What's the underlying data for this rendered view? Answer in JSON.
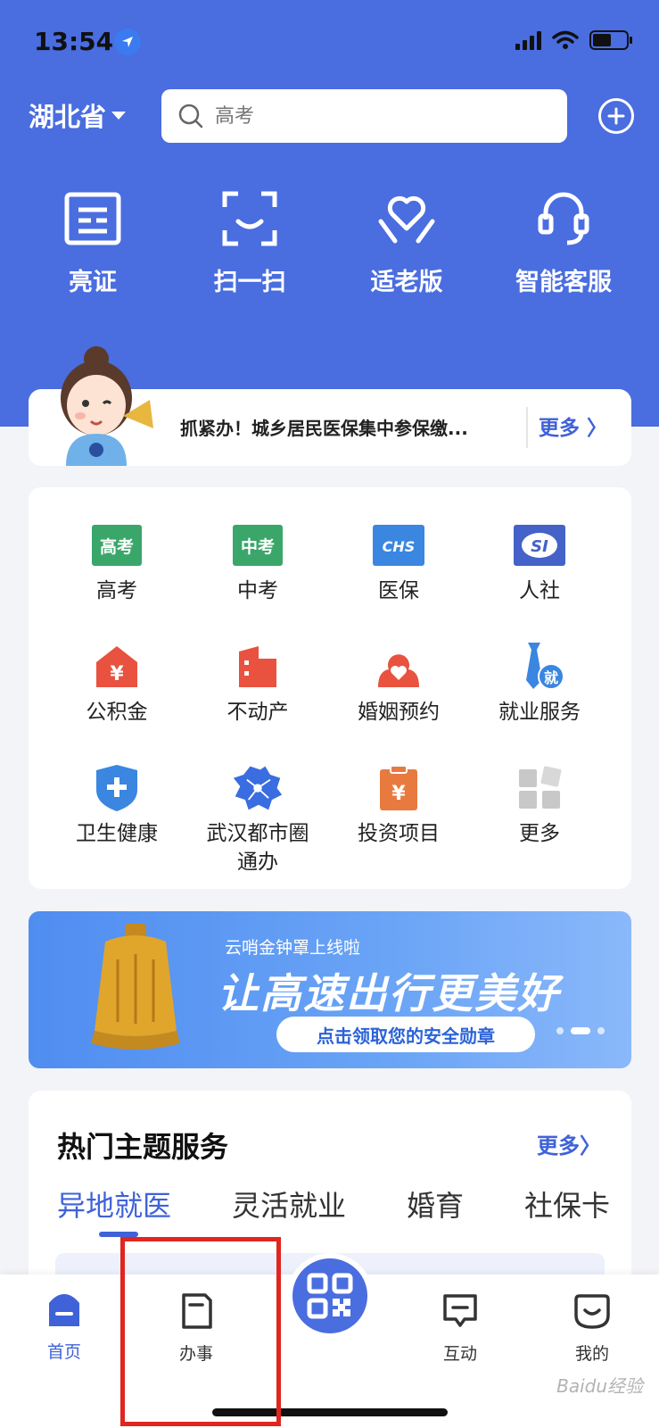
{
  "status_bar": {
    "time": "13:54"
  },
  "header": {
    "province": "湖北省",
    "search_placeholder": "高考"
  },
  "quick_actions": [
    {
      "label": "亮证",
      "icon": "id-card-icon"
    },
    {
      "label": "扫一扫",
      "icon": "scan-icon"
    },
    {
      "label": "适老版",
      "icon": "elderly-care-icon"
    },
    {
      "label": "智能客服",
      "icon": "headset-icon"
    }
  ],
  "notice": {
    "text": "抓紧办！城乡居民医保集中参保缴...",
    "more": "更多 〉"
  },
  "services": [
    {
      "label": "高考",
      "icon": "gaokao-icon",
      "badge": "高考",
      "color": "#3aa66a"
    },
    {
      "label": "中考",
      "icon": "zhongkao-icon",
      "badge": "中考",
      "color": "#3aa66a"
    },
    {
      "label": "医保",
      "icon": "chs-icon",
      "badge": "CHS",
      "color": "#3a86e0"
    },
    {
      "label": "人社",
      "icon": "social-security-icon",
      "badge": "SI",
      "color": "#4462c8"
    },
    {
      "label": "公积金",
      "icon": "housing-fund-icon",
      "badge": "¥",
      "color": "#e8523f"
    },
    {
      "label": "不动产",
      "icon": "real-estate-icon",
      "color": "#e8523f"
    },
    {
      "label": "婚姻预约",
      "icon": "marriage-icon",
      "color": "#e8523f"
    },
    {
      "label": "就业服务",
      "icon": "employment-icon",
      "badge": "就",
      "color": "#3a86e0"
    },
    {
      "label": "卫生健康",
      "icon": "health-icon",
      "color": "#3a86e0"
    },
    {
      "label": "武汉都市圈\n通办",
      "icon": "wuhan-map-icon",
      "color": "#3a6de0"
    },
    {
      "label": "投资项目",
      "icon": "investment-icon",
      "badge": "¥",
      "color": "#e87a3f"
    },
    {
      "label": "更多",
      "icon": "more-grid-icon",
      "color": "#c8c8c8"
    }
  ],
  "banner": {
    "subtitle": "云哨金钟罩上线啦",
    "title": "让高速出行更美好",
    "button": "点击领取您的安全勋章"
  },
  "topics": {
    "title": "热门主题服务",
    "more": "更多〉",
    "tabs": [
      "异地就医",
      "灵活就业",
      "婚育",
      "社保卡"
    ]
  },
  "bottom_nav": [
    {
      "label": "首页",
      "icon": "home-icon"
    },
    {
      "label": "办事",
      "icon": "document-icon"
    },
    {
      "label": "",
      "icon": "qr-code-icon"
    },
    {
      "label": "互动",
      "icon": "message-icon"
    },
    {
      "label": "我的",
      "icon": "profile-icon"
    }
  ],
  "watermark": "Baidu经验"
}
